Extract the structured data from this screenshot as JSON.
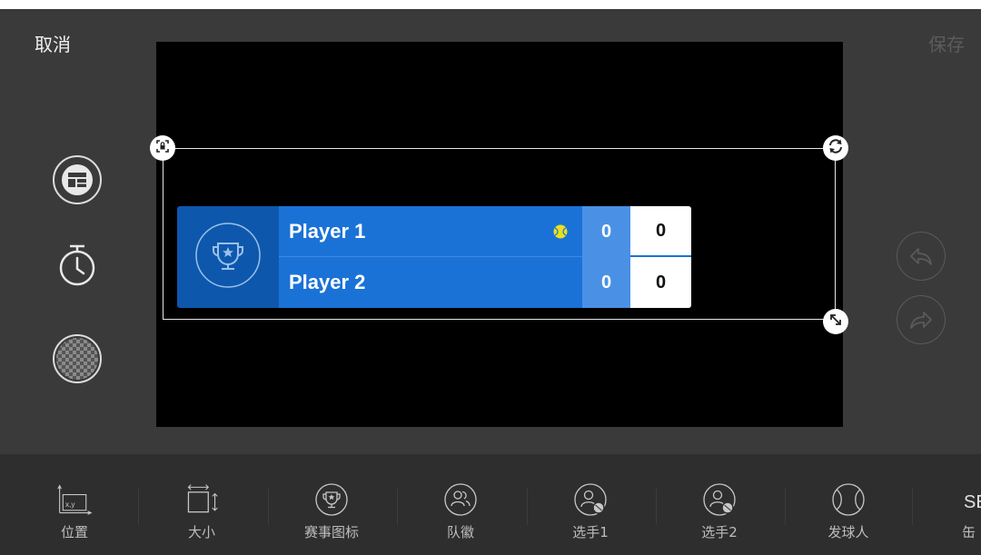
{
  "header": {
    "cancel_label": "取消",
    "save_label": "保存"
  },
  "scoreboard": {
    "players": [
      {
        "name": "Player 1",
        "set_score": "0",
        "game_score": "0",
        "serving": true
      },
      {
        "name": "Player 2",
        "set_score": "0",
        "game_score": "0",
        "serving": false
      }
    ],
    "colors": {
      "logo_bg": "#0d58ad",
      "name_bg": "#1b72d6",
      "set_bg": "#4a91e6",
      "game_bg": "#ffffff",
      "serve_ball": "#e8e020"
    }
  },
  "side_tools": [
    {
      "icon": "layout-icon"
    },
    {
      "icon": "timer-icon"
    },
    {
      "icon": "transparency-icon"
    }
  ],
  "history": [
    {
      "icon": "undo-icon"
    },
    {
      "icon": "redo-icon"
    }
  ],
  "toolbar": {
    "items": [
      {
        "label": "位置",
        "icon": "position-icon"
      },
      {
        "label": "大小",
        "icon": "size-icon"
      },
      {
        "label": "赛事图标",
        "icon": "trophy-icon"
      },
      {
        "label": "队徽",
        "icon": "team-badge-icon"
      },
      {
        "label": "选手1",
        "icon": "player-icon"
      },
      {
        "label": "选手2",
        "icon": "player-icon"
      },
      {
        "label": "发球人",
        "icon": "tennis-ball-icon"
      }
    ],
    "cut_item": {
      "icon_text": "SE",
      "label": "缶"
    }
  }
}
